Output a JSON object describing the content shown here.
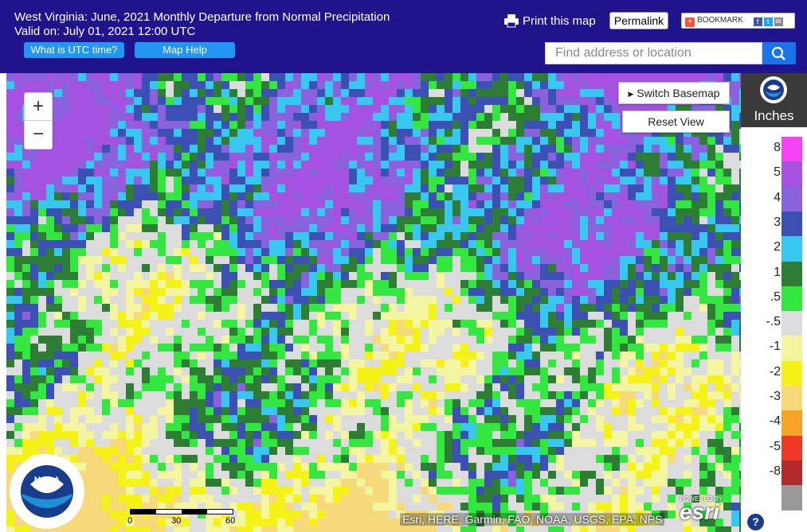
{
  "header": {
    "title": "West Virginia: June, 2021 Monthly Departure from Normal Precipitation",
    "valid": "Valid on: July 01, 2021 12:00 UTC",
    "utc_button": "What is UTC time?",
    "help_button": "Map Help",
    "print_label": "Print this map",
    "permalink_label": "Permalink",
    "bookmark_label": "BOOKMARK",
    "search_placeholder": "Find address or location"
  },
  "map": {
    "zoom_in": "+",
    "zoom_out": "−",
    "switch_basemap": "Switch Basemap",
    "reset_view": "Reset View",
    "attribution": "Esri, HERE, Garmin, FAO, NOAA, USGS, EPA, NPS",
    "esri_powered": "POWERED BY",
    "esri_name": "esri",
    "scale_labels": [
      "0",
      "30",
      "60"
    ]
  },
  "legend": {
    "unit": "Inches",
    "classes": [
      {
        "label": "8",
        "color": "#f542f5"
      },
      {
        "label": "5",
        "color": "#a552e0"
      },
      {
        "label": "4",
        "color": "#8a62de"
      },
      {
        "label": "3",
        "color": "#3c4fb3"
      },
      {
        "label": "2",
        "color": "#38c7ee"
      },
      {
        "label": "1",
        "color": "#2e7d35"
      },
      {
        "label": ".5",
        "color": "#33e640"
      },
      {
        "label": "-.5",
        "color": "#dcdcdc"
      },
      {
        "label": "-1",
        "color": "#f3f5a0"
      },
      {
        "label": "-2",
        "color": "#f5f218"
      },
      {
        "label": "-3",
        "color": "#f5d97a"
      },
      {
        "label": "-4",
        "color": "#f5a428"
      },
      {
        "label": "-5",
        "color": "#ec3a26"
      },
      {
        "label": "-8",
        "color": "#b22a2a"
      },
      {
        "label": "",
        "color": "#999999"
      }
    ]
  },
  "help_icon": "?",
  "logo_text": "NOAA"
}
